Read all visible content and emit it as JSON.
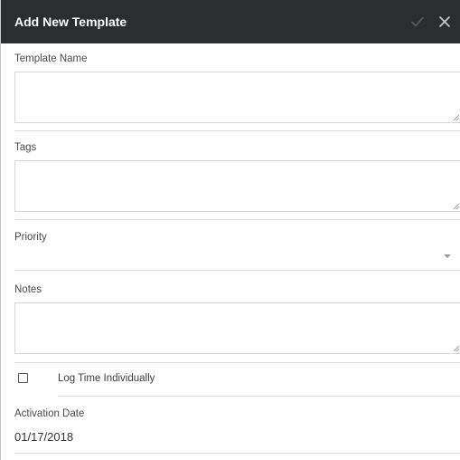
{
  "dialog": {
    "title": "Add New Template",
    "confirm_icon": "checkmark-icon",
    "close_icon": "close-icon"
  },
  "fields": {
    "template_name": {
      "label": "Template Name",
      "value": ""
    },
    "tags": {
      "label": "Tags",
      "value": ""
    },
    "priority": {
      "label": "Priority",
      "selected": ""
    },
    "notes": {
      "label": "Notes",
      "value": ""
    },
    "log_time": {
      "label": "Log Time Individually",
      "checked": false
    },
    "activation_date": {
      "label": "Activation Date",
      "value": "01/17/2018"
    }
  },
  "colors": {
    "header_bg": "#2c2d31",
    "header_text": "#ffffff",
    "border": "#d6d6d6"
  }
}
